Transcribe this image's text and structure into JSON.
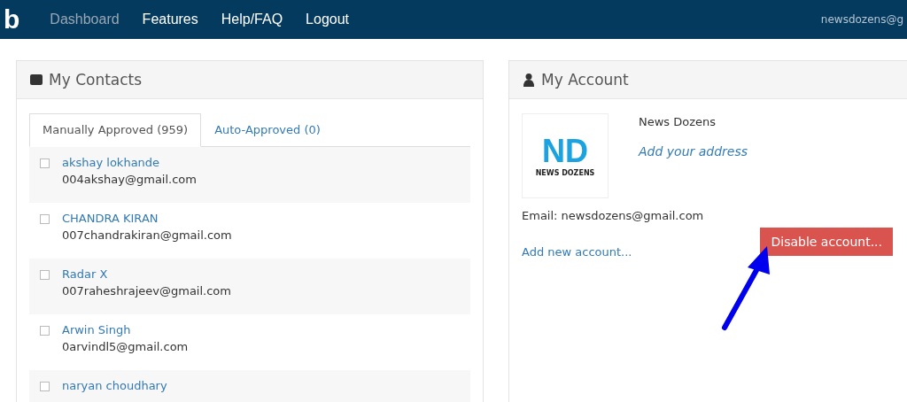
{
  "navbar": {
    "logo": "b",
    "items": [
      {
        "label": "Dashboard",
        "selected": true
      },
      {
        "label": "Features",
        "selected": false
      },
      {
        "label": "Help/FAQ",
        "selected": false
      },
      {
        "label": "Logout",
        "selected": false
      }
    ],
    "user": "newsdozens@g"
  },
  "contacts": {
    "title": "My Contacts",
    "tabs": [
      {
        "label": "Manually Approved (959)",
        "selected": true
      },
      {
        "label": "Auto-Approved (0)",
        "selected": false
      }
    ],
    "rows": [
      {
        "name": "akshay lokhande",
        "email": "004akshay@gmail.com",
        "checked": false
      },
      {
        "name": "CHANDRA KIRAN",
        "email": "007chandrakiran@gmail.com",
        "checked": false
      },
      {
        "name": "Radar X",
        "email": "007raheshrajeev@gmail.com",
        "checked": false
      },
      {
        "name": "Arwin Singh",
        "email": "0arvindl5@gmail.com",
        "checked": false
      },
      {
        "name": "naryan choudhary",
        "checked": false
      }
    ]
  },
  "account": {
    "title": "My Account",
    "logo": {
      "initials": "ND",
      "caption": "NEWS DOZENS"
    },
    "name": "News Dozens",
    "address_link": "Add your address",
    "email": "Email: newsdozens@gmail.com",
    "add_link": "Add new account...",
    "disable_button": "Disable account..."
  }
}
